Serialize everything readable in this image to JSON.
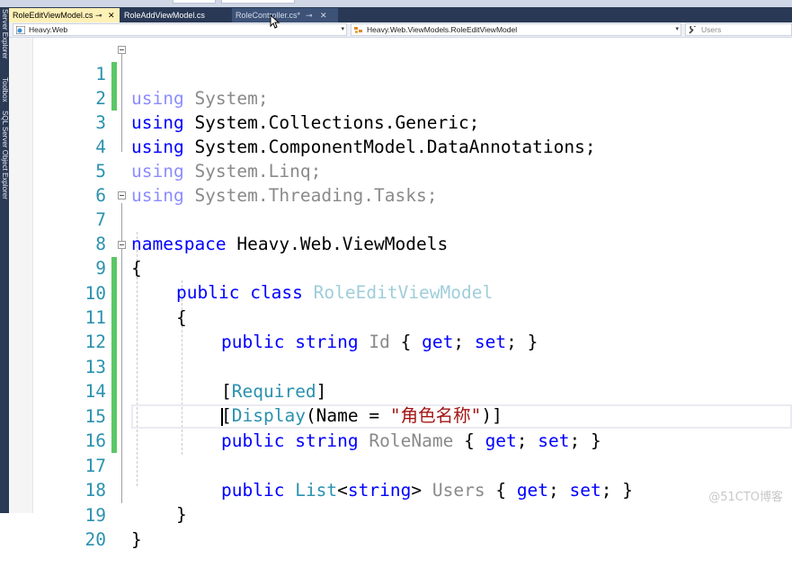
{
  "side_panels": [
    "Server Explorer",
    "Toolbox",
    "SQL Server Object Explorer"
  ],
  "tabs": [
    {
      "label": "RoleEditViewModel.cs",
      "state": "active",
      "pin": "⊸",
      "close": "✕"
    },
    {
      "label": "RoleAddViewModel.cs",
      "state": "inactive"
    },
    {
      "label": "RoleController.cs*",
      "state": "hover",
      "pin": "⊸",
      "close": "✕"
    }
  ],
  "navbar": {
    "project": "Heavy.Web",
    "type": "Heavy.Web.ViewModels.RoleEditViewModel",
    "member": "Users",
    "arrow": "▾"
  },
  "code_lines": [
    {
      "n": "1"
    },
    {
      "n": "2"
    },
    {
      "n": "3"
    },
    {
      "n": "4"
    },
    {
      "n": "5"
    },
    {
      "n": "6"
    },
    {
      "n": "7"
    },
    {
      "n": "8"
    },
    {
      "n": "9"
    },
    {
      "n": "10"
    },
    {
      "n": "11"
    },
    {
      "n": "12"
    },
    {
      "n": "13"
    },
    {
      "n": "14"
    },
    {
      "n": "15"
    },
    {
      "n": "16"
    },
    {
      "n": "17"
    },
    {
      "n": "18"
    },
    {
      "n": "19"
    },
    {
      "n": "20"
    }
  ],
  "tokens": {
    "using": "using",
    "system": " System;",
    "collections": " System.Collections.Generic;",
    "annotations": " System.ComponentModel.DataAnnotations;",
    "linq": " System.Linq;",
    "tasks": " System.Threading.Tasks;",
    "namespace_kw": "namespace",
    "namespace_name": " Heavy.Web.ViewModels",
    "open_brace": "{",
    "close_brace": "}",
    "public": "public",
    "class": "class",
    "class_name": "RoleEditViewModel",
    "string": "string",
    "id": "Id",
    "accessor_open": "{ ",
    "get": "get",
    "set": "set",
    "semi": "; ",
    "accessor_close": "}",
    "lbracket": "[",
    "rbracket": "]",
    "required": "Required",
    "display": "Display",
    "display_args_open": "(Name = ",
    "display_name_value": "\"角色名称\"",
    "display_args_close": ")",
    "role_name": "RoleName",
    "list": "List",
    "lt": "<",
    "gt": ">",
    "users": "Users",
    "space": " "
  },
  "watermark": "@51CTO博客"
}
